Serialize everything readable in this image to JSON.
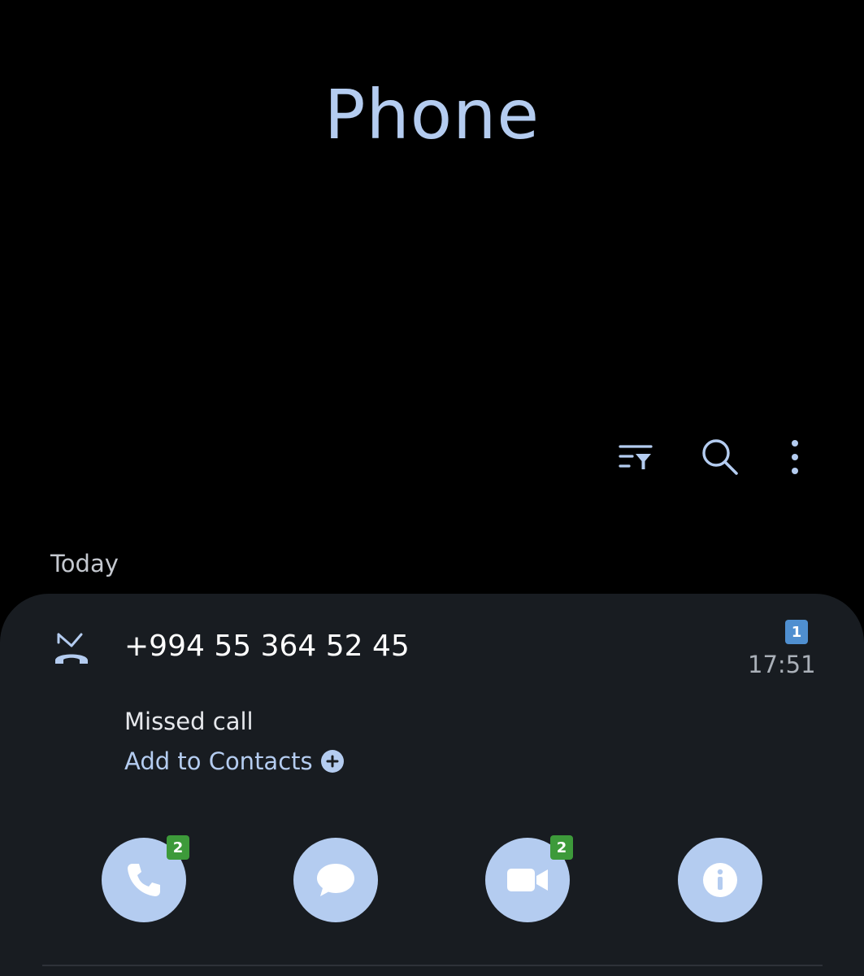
{
  "app": {
    "title": "Phone"
  },
  "toolbar": {
    "filter_icon": "filter-list-icon",
    "search_icon": "search-icon",
    "more_icon": "more-vertical-icon"
  },
  "call_log": {
    "section_label": "Today",
    "entries": [
      {
        "number": "+994 55 364 52 45",
        "sim_slot": "1",
        "time": "17:51",
        "status": "Missed call",
        "add_to_contacts_label": "Add to Contacts",
        "actions": {
          "call_badge": "2",
          "video_badge": "2"
        }
      }
    ]
  },
  "colors": {
    "accent": "#b4ccf0",
    "card_background": "#181c21",
    "sim_badge": "#4f8fd0",
    "count_badge": "#3d9a3a"
  }
}
